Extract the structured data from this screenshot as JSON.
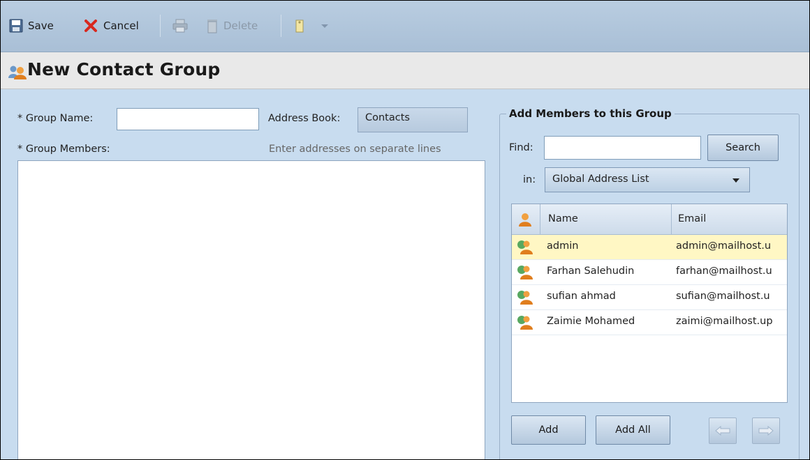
{
  "toolbar": {
    "save_label": "Save",
    "cancel_label": "Cancel",
    "delete_label": "Delete"
  },
  "title": "New Contact Group",
  "form": {
    "group_name_label": "* Group Name:",
    "group_name_value": "",
    "address_book_label": "Address Book:",
    "address_book_value": "Contacts",
    "group_members_label": "* Group Members:",
    "group_members_hint": "Enter addresses on separate lines",
    "group_members_value": ""
  },
  "add_members": {
    "legend": "Add Members to this Group",
    "find_label": "Find:",
    "find_value": "",
    "search_button": "Search",
    "in_label": "in:",
    "in_value": "Global Address List",
    "columns": {
      "name": "Name",
      "email": "Email"
    },
    "rows": [
      {
        "name": "admin",
        "email": "admin@mailhost.u",
        "selected": true
      },
      {
        "name": "Farhan Salehudin",
        "email": "farhan@mailhost.u",
        "selected": false
      },
      {
        "name": "sufian ahmad",
        "email": "sufian@mailhost.u",
        "selected": false
      },
      {
        "name": "Zaimie Mohamed",
        "email": "zaimi@mailhost.up",
        "selected": false
      }
    ],
    "add_button": "Add",
    "add_all_button": "Add All"
  },
  "colors": {
    "toolbar": "#b0c5db",
    "panel": "#c8dcef",
    "selected_row": "#fff7c4"
  }
}
